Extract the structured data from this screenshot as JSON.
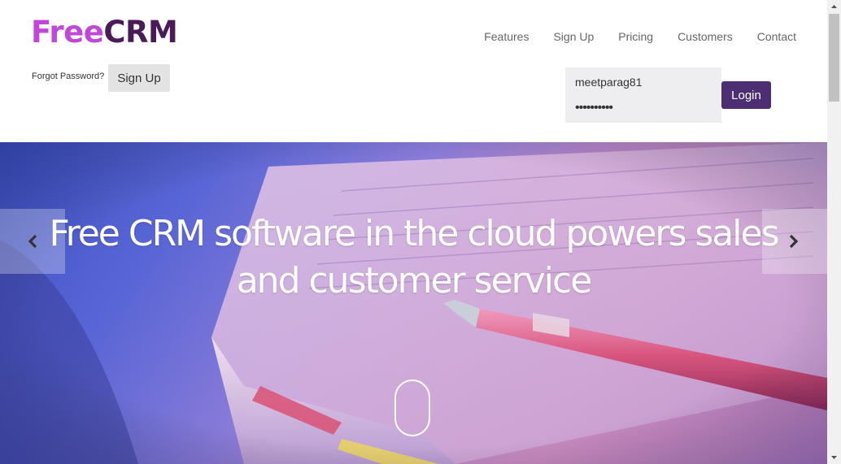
{
  "header": {
    "logo": {
      "part1": "Free",
      "part2": "CRM"
    },
    "nav": [
      "Features",
      "Sign Up",
      "Pricing",
      "Customers",
      "Contact"
    ],
    "forgot_password": "Forgot Password?",
    "signup_label": "Sign Up",
    "login": {
      "username_value": "meetparag81",
      "password_value": "••••••••••",
      "button_label": "Login"
    }
  },
  "hero": {
    "title": "Free CRM software in the cloud powers sales and customer service",
    "prev_icon": "chevron-left-icon",
    "next_icon": "chevron-right-icon",
    "scroll_icon": "mouse-scroll-icon"
  },
  "colors": {
    "logo_free": "#c047d8",
    "logo_crm": "#4b1a58",
    "login_button": "#4d2e72",
    "signup_button": "#e3e3e3",
    "login_box": "#eeeef1"
  }
}
